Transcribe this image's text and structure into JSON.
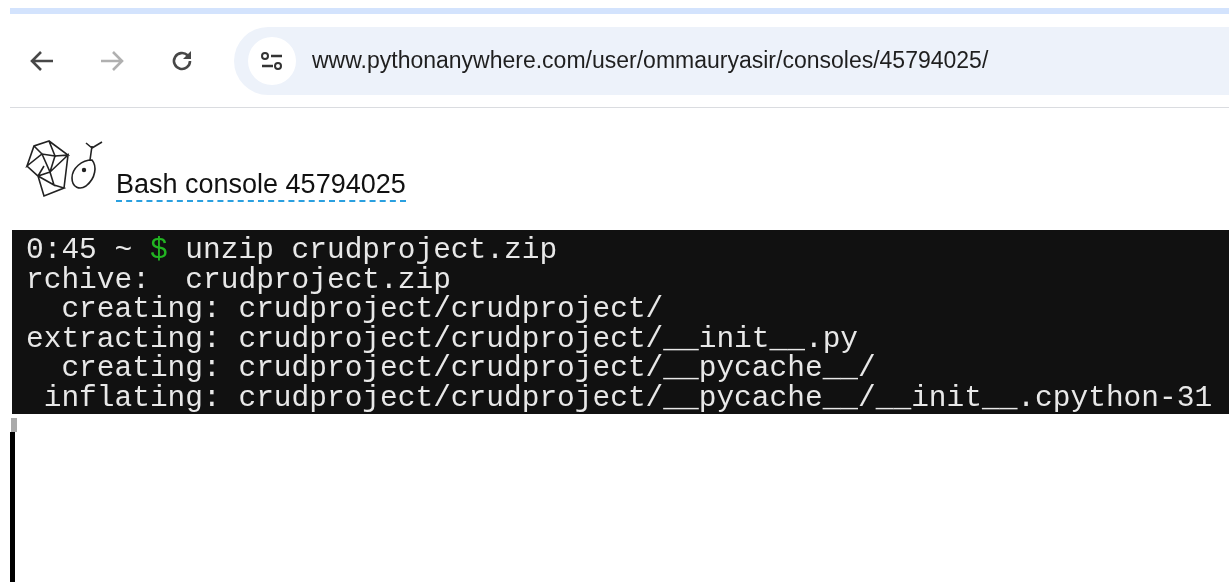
{
  "browser": {
    "url": "www.pythonanywhere.com/user/ommauryasir/consoles/45794025/",
    "forward_disabled": true
  },
  "page": {
    "title": "Bash console 45794025"
  },
  "terminal": {
    "lines": [
      {
        "kind": "prompt",
        "prompt": "0:45 ~ ",
        "symbol": "$",
        "command": " unzip crudproject.zip"
      },
      {
        "kind": "output",
        "text": "rchive:  crudproject.zip"
      },
      {
        "kind": "output",
        "text": "  creating: crudproject/crudproject/"
      },
      {
        "kind": "output",
        "text": "extracting: crudproject/crudproject/__init__.py"
      },
      {
        "kind": "output",
        "text": "  creating: crudproject/crudproject/__pycache__/"
      },
      {
        "kind": "output",
        "text": " inflating: crudproject/crudproject/__pycache__/__init__.cpython-31"
      }
    ]
  }
}
